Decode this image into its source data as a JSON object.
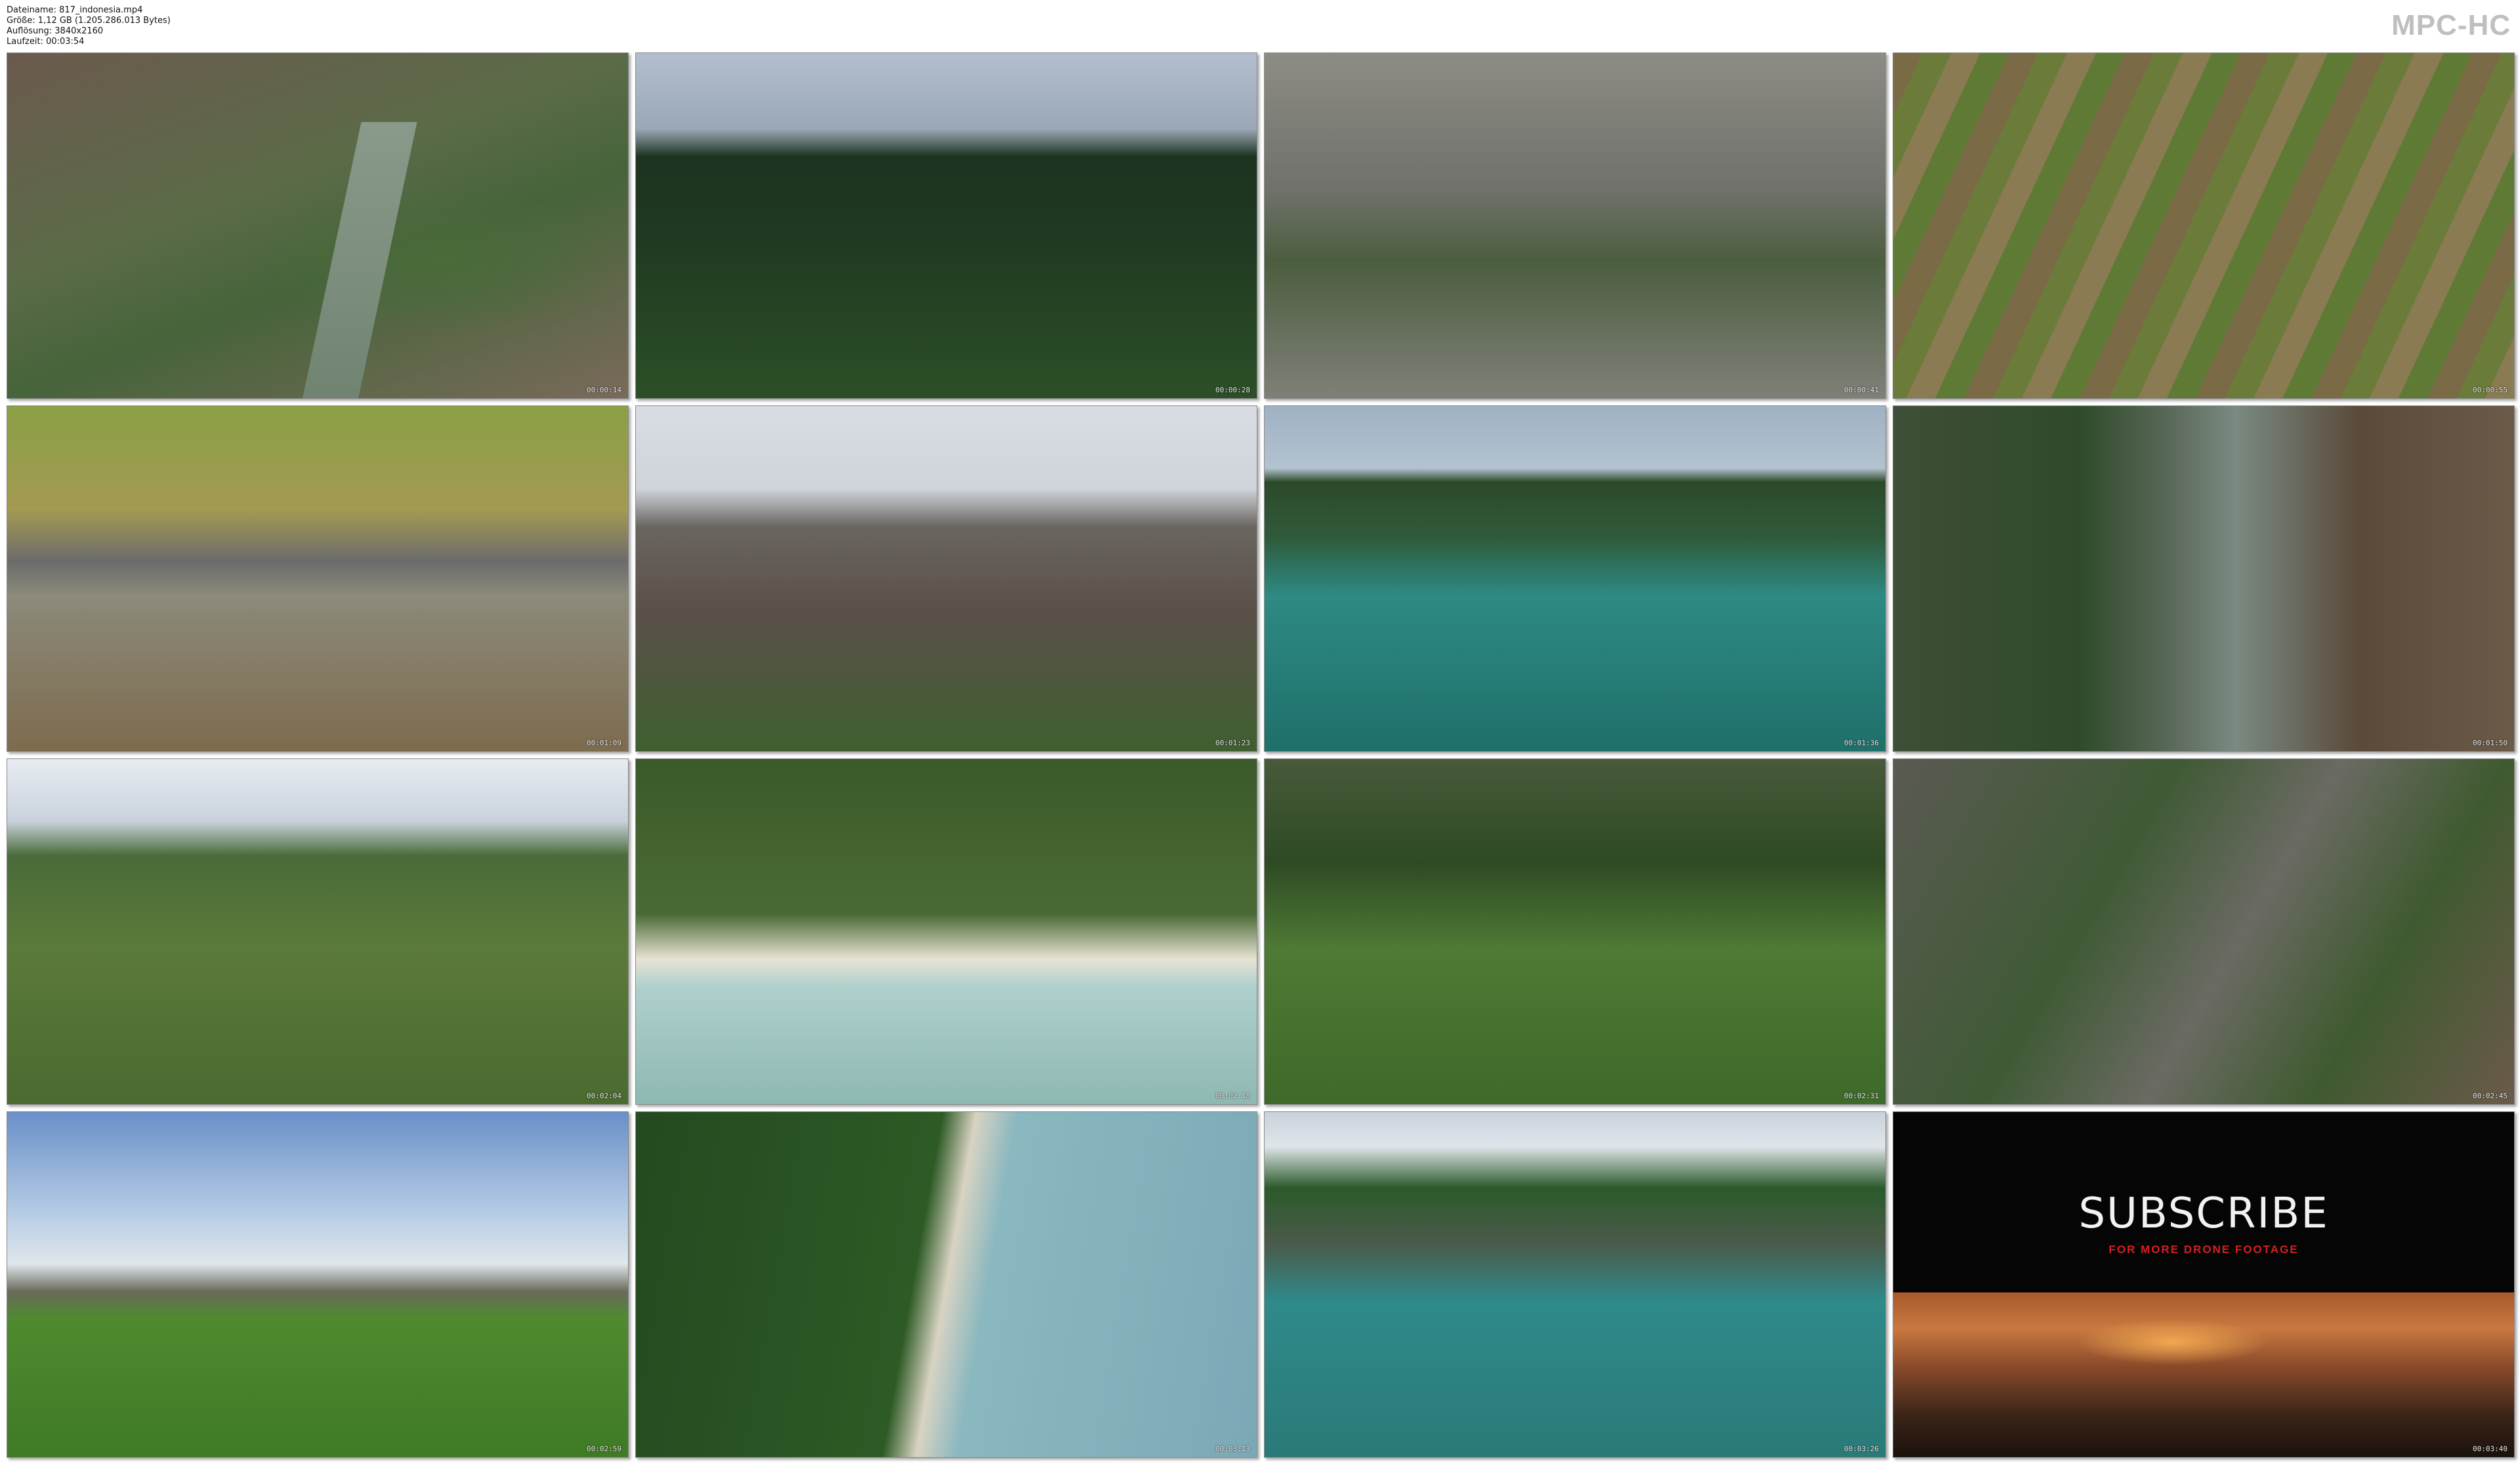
{
  "header": {
    "filename": "Dateiname: 817_indonesia.mp4",
    "size": "Größe: 1,12 GB (1.205.286.013 Bytes)",
    "resolution": "Auflösung: 3840x2160",
    "duration": "Laufzeit: 00:03:54"
  },
  "logo": "MPC-HC",
  "thumbnails": [
    {
      "time": "00:00:14"
    },
    {
      "time": "00:00:28"
    },
    {
      "time": "00:00:41"
    },
    {
      "time": "00:00:55"
    },
    {
      "time": "00:01:09"
    },
    {
      "time": "00:01:23"
    },
    {
      "time": "00:01:36"
    },
    {
      "time": "00:01:50"
    },
    {
      "time": "00:02:04"
    },
    {
      "time": "00:02:18"
    },
    {
      "time": "00:02:31"
    },
    {
      "time": "00:02:45"
    },
    {
      "time": "00:02:59"
    },
    {
      "time": "00:03:13"
    },
    {
      "time": "00:03:26"
    },
    {
      "time": "00:03:40"
    }
  ],
  "promo": {
    "title": "SUBSCRIBE",
    "subtitle": "FOR MORE DRONE FOOTAGE"
  }
}
